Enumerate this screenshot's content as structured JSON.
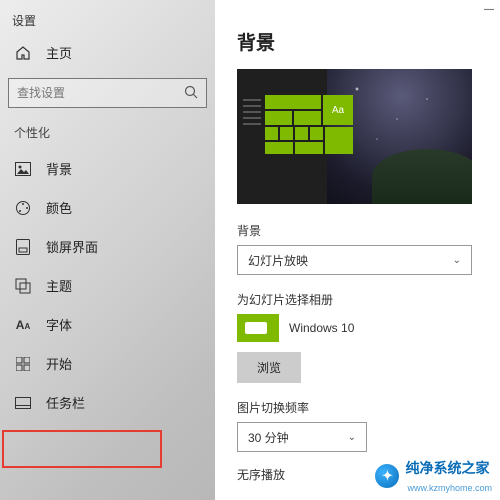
{
  "window": {
    "title": "设置",
    "minimize": "—"
  },
  "sidebar": {
    "home": "主页",
    "search_placeholder": "查找设置",
    "section": "个性化",
    "items": [
      {
        "label": "背景"
      },
      {
        "label": "颜色"
      },
      {
        "label": "锁屏界面"
      },
      {
        "label": "主题"
      },
      {
        "label": "字体"
      },
      {
        "label": "开始"
      },
      {
        "label": "任务栏"
      }
    ]
  },
  "content": {
    "heading": "背景",
    "preview_tile_text": "Aa",
    "bg_label": "背景",
    "bg_select": "幻灯片放映",
    "album_label": "为幻灯片选择相册",
    "album_name": "Windows 10",
    "browse": "浏览",
    "freq_label": "图片切换频率",
    "freq_value": "30 分钟",
    "shuffle_label": "无序播放"
  },
  "watermark": {
    "text": "纯净系统之家",
    "url": "www.kzmyhome.com"
  }
}
